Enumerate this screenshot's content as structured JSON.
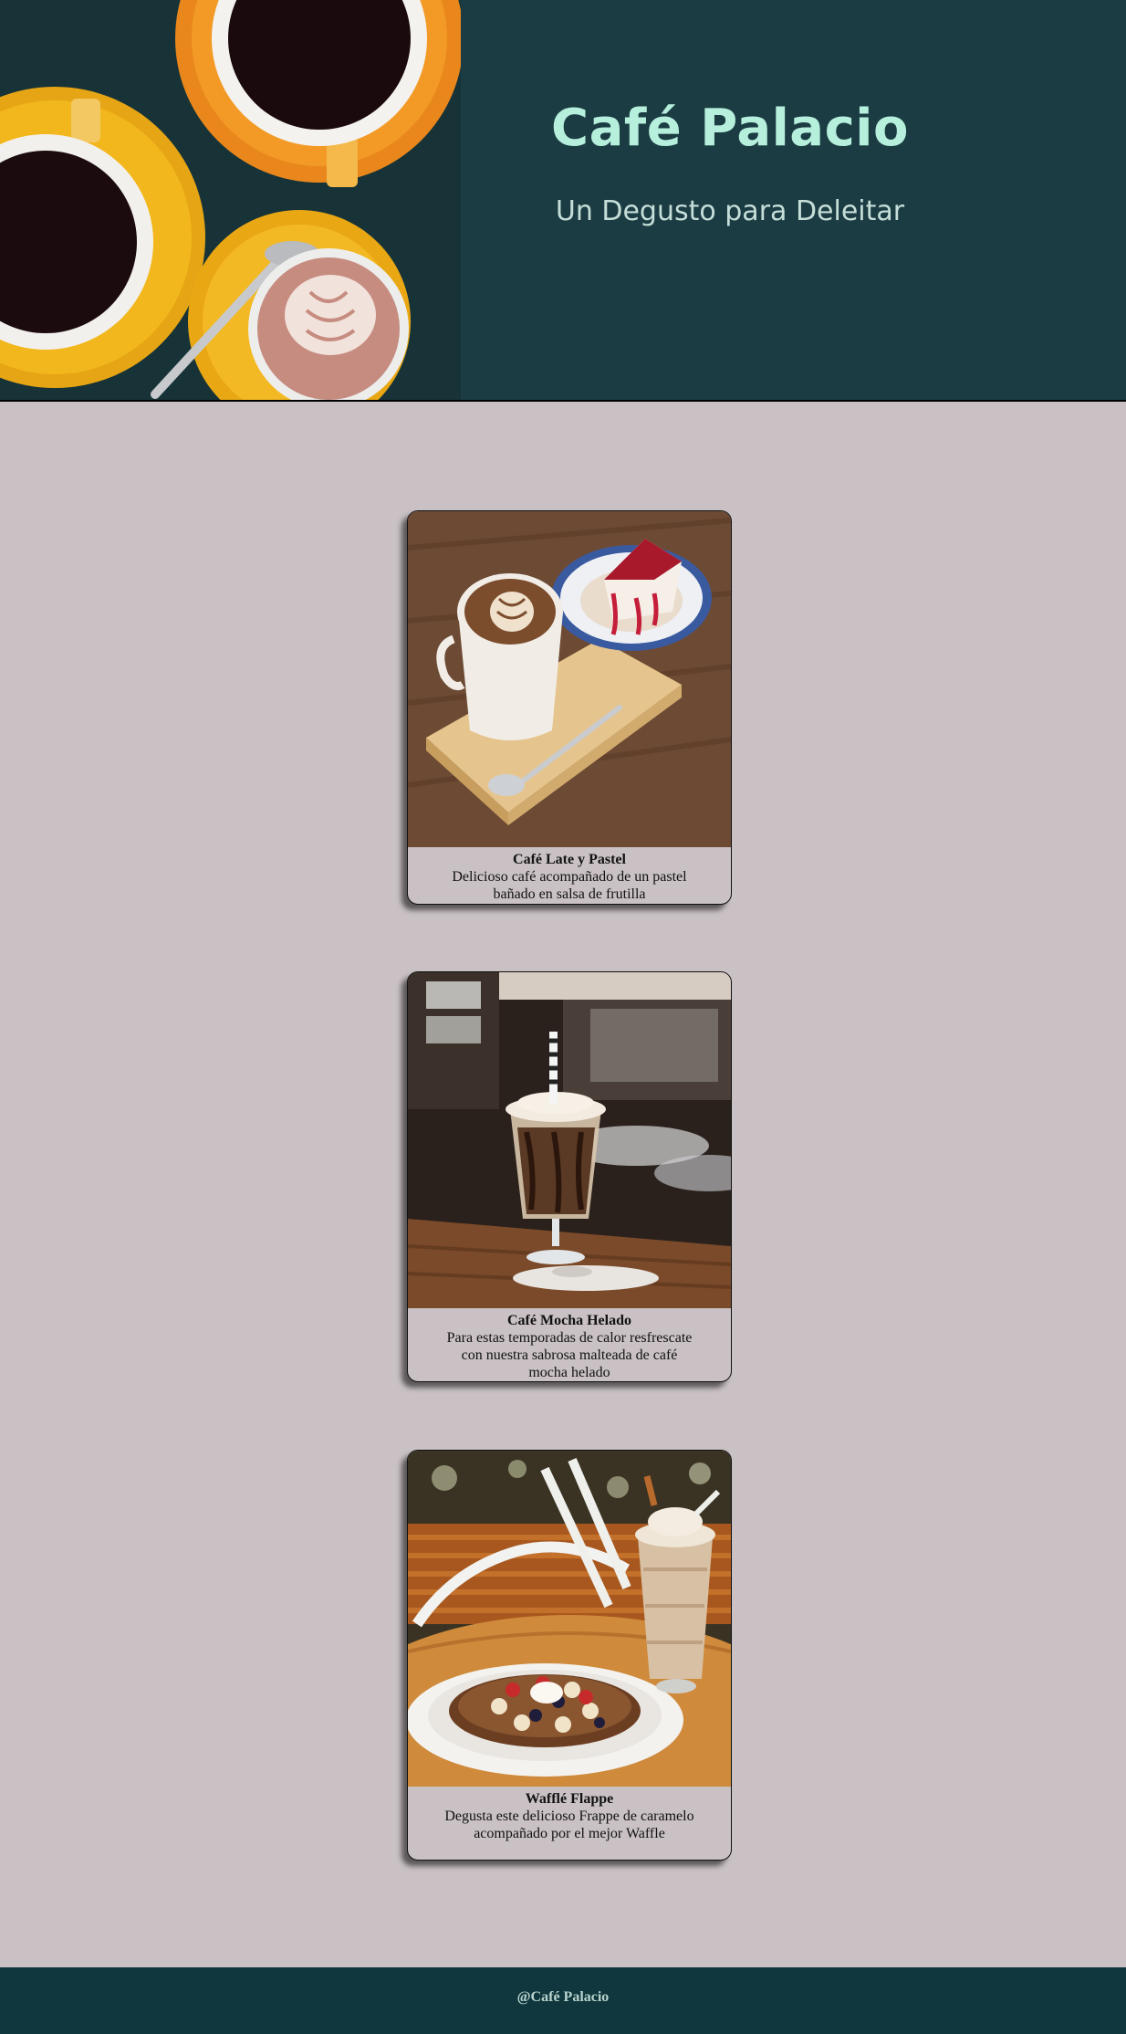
{
  "header": {
    "title": "Café Palacio",
    "tagline": "Un Degusto para Deleitar",
    "image_icon": "coffee-cups-image"
  },
  "cards": [
    {
      "image_icon": "latte-and-cake-image",
      "title": "Café Late y Pastel",
      "description": "Delicioso café acompañado de un pastel bañado en salsa de frutilla"
    },
    {
      "image_icon": "mocha-frappe-image",
      "title": "Café Mocha Helado",
      "description": "Para estas temporadas de calor resfrescate con nuestra sabrosa malteada de café mocha helado"
    },
    {
      "image_icon": "waffle-and-frappe-image",
      "title": "Wafflé Flappe",
      "description": "Degusta este delicioso Frappe de caramelo acompañado por el mejor Waffle"
    }
  ],
  "footer": {
    "text": "@Café Palacio"
  },
  "colors": {
    "header_bg": "#1b3c43",
    "title": "#b6f0dc",
    "page_bg": "#c9c1c4",
    "footer_bg": "#0f373d"
  }
}
